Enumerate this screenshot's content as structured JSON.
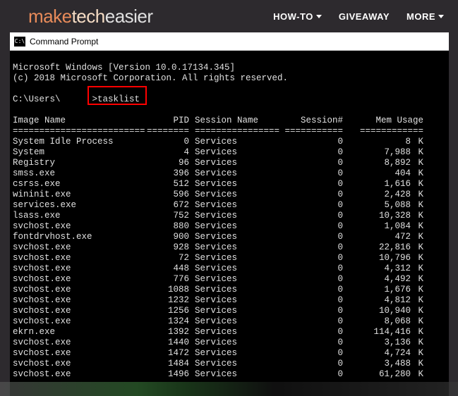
{
  "site": {
    "logo_part1": "make",
    "logo_part2": "tech",
    "logo_part3": "easier",
    "nav": [
      "HOW-TO",
      "GIVEAWAY",
      "MORE"
    ]
  },
  "window": {
    "title": "Command Prompt"
  },
  "terminal": {
    "version_line": "Microsoft Windows [Version 10.0.17134.345]",
    "copyright_line": "(c) 2018 Microsoft Corporation. All rights reserved.",
    "prompt_path": "C:\\Users\\",
    "prompt_cmd": ">tasklist",
    "headers": {
      "image": "Image Name",
      "pid": "PID",
      "session": "Session Name",
      "snum": "Session#",
      "mem": "Mem Usage"
    },
    "sep": {
      "image": "=========================",
      "pid": "========",
      "session": "================",
      "snum": "===========",
      "mem": "============"
    },
    "rows": [
      {
        "name": "System Idle Process",
        "pid": "0",
        "sess": "Services",
        "snum": "0",
        "mem": "8",
        "k": "K"
      },
      {
        "name": "System",
        "pid": "4",
        "sess": "Services",
        "snum": "0",
        "mem": "7,988",
        "k": "K"
      },
      {
        "name": "Registry",
        "pid": "96",
        "sess": "Services",
        "snum": "0",
        "mem": "8,892",
        "k": "K"
      },
      {
        "name": "smss.exe",
        "pid": "396",
        "sess": "Services",
        "snum": "0",
        "mem": "404",
        "k": "K"
      },
      {
        "name": "csrss.exe",
        "pid": "512",
        "sess": "Services",
        "snum": "0",
        "mem": "1,616",
        "k": "K"
      },
      {
        "name": "wininit.exe",
        "pid": "596",
        "sess": "Services",
        "snum": "0",
        "mem": "2,428",
        "k": "K"
      },
      {
        "name": "services.exe",
        "pid": "672",
        "sess": "Services",
        "snum": "0",
        "mem": "5,088",
        "k": "K"
      },
      {
        "name": "lsass.exe",
        "pid": "752",
        "sess": "Services",
        "snum": "0",
        "mem": "10,328",
        "k": "K"
      },
      {
        "name": "svchost.exe",
        "pid": "880",
        "sess": "Services",
        "snum": "0",
        "mem": "1,084",
        "k": "K"
      },
      {
        "name": "fontdrvhost.exe",
        "pid": "900",
        "sess": "Services",
        "snum": "0",
        "mem": "472",
        "k": "K"
      },
      {
        "name": "svchost.exe",
        "pid": "928",
        "sess": "Services",
        "snum": "0",
        "mem": "22,816",
        "k": "K"
      },
      {
        "name": "svchost.exe",
        "pid": "72",
        "sess": "Services",
        "snum": "0",
        "mem": "10,796",
        "k": "K"
      },
      {
        "name": "svchost.exe",
        "pid": "448",
        "sess": "Services",
        "snum": "0",
        "mem": "4,312",
        "k": "K"
      },
      {
        "name": "svchost.exe",
        "pid": "776",
        "sess": "Services",
        "snum": "0",
        "mem": "4,492",
        "k": "K"
      },
      {
        "name": "svchost.exe",
        "pid": "1088",
        "sess": "Services",
        "snum": "0",
        "mem": "1,676",
        "k": "K"
      },
      {
        "name": "svchost.exe",
        "pid": "1232",
        "sess": "Services",
        "snum": "0",
        "mem": "4,812",
        "k": "K"
      },
      {
        "name": "svchost.exe",
        "pid": "1256",
        "sess": "Services",
        "snum": "0",
        "mem": "10,940",
        "k": "K"
      },
      {
        "name": "svchost.exe",
        "pid": "1324",
        "sess": "Services",
        "snum": "0",
        "mem": "8,068",
        "k": "K"
      },
      {
        "name": "ekrn.exe",
        "pid": "1392",
        "sess": "Services",
        "snum": "0",
        "mem": "114,416",
        "k": "K"
      },
      {
        "name": "svchost.exe",
        "pid": "1440",
        "sess": "Services",
        "snum": "0",
        "mem": "3,136",
        "k": "K"
      },
      {
        "name": "svchost.exe",
        "pid": "1472",
        "sess": "Services",
        "snum": "0",
        "mem": "4,724",
        "k": "K"
      },
      {
        "name": "svchost.exe",
        "pid": "1484",
        "sess": "Services",
        "snum": "0",
        "mem": "3,488",
        "k": "K"
      },
      {
        "name": "svchost.exe",
        "pid": "1496",
        "sess": "Services",
        "snum": "0",
        "mem": "61,280",
        "k": "K"
      }
    ]
  }
}
